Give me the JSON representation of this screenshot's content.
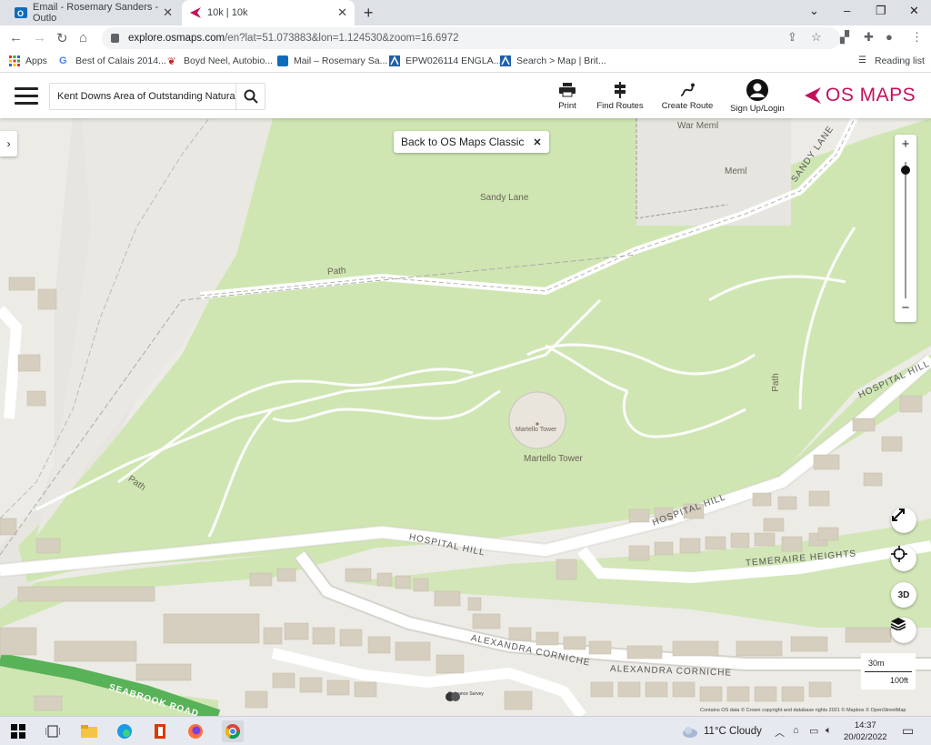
{
  "browser": {
    "tabs": [
      {
        "title": "Email - Rosemary Sanders - Outlo",
        "active": false
      },
      {
        "title": "10k | 10k",
        "active": true
      }
    ],
    "new_tab": "+",
    "window_controls": {
      "minimize": "⌄",
      "restore": "–",
      "maximize": "❐",
      "close": "✕"
    },
    "url_host": "explore.osmaps.com",
    "url_path": "/en?lat=51.073883&lon=1.124530&zoom=16.6972",
    "bookmarks": [
      {
        "label": "Apps",
        "icon": "apps-icon"
      },
      {
        "label": "Best of Calais 2014...",
        "icon": "google-icon"
      },
      {
        "label": "Boyd Neel, Autobio...",
        "icon": "bird-icon"
      },
      {
        "label": "Mail – Rosemary Sa...",
        "icon": "outlook-icon"
      },
      {
        "label": "EPW026114 ENGLA...",
        "icon": "historic-england-icon"
      },
      {
        "label": "Search > Map | Brit...",
        "icon": "historic-england-icon"
      }
    ],
    "reading_list": "Reading list"
  },
  "app": {
    "search_value": "Kent Downs Area of Outstanding Natural",
    "actions": [
      {
        "label": "Print",
        "icon": "printer-icon"
      },
      {
        "label": "Find Routes",
        "icon": "route-sign-icon"
      },
      {
        "label": "Create Route",
        "icon": "create-route-icon"
      },
      {
        "label": "Sign Up/Login",
        "icon": "user-icon"
      }
    ],
    "brand": "OS MAPS",
    "brand_color": "#c3105d"
  },
  "map": {
    "banner": "Back to OS Maps Classic",
    "banner_close": "✕",
    "side_toggle": "›",
    "zoom_in": "+",
    "zoom_out": "−",
    "zoom_level": 16.6972,
    "controls": [
      {
        "name": "fullscreen",
        "label": "",
        "icon": "expand-icon"
      },
      {
        "name": "locate",
        "label": "",
        "icon": "crosshair-icon"
      },
      {
        "name": "3d",
        "label": "3D",
        "icon": "3d-rotate-icon"
      },
      {
        "name": "layers",
        "label": "",
        "icon": "layers-icon"
      }
    ],
    "labels": {
      "war_meml": "War Meml",
      "meml": "Meml",
      "sandy_lane_area": "Sandy Lane",
      "sandy_lane_road": "SANDY LANE",
      "path_north": "Path",
      "path_west": "Path",
      "path_east": "Path",
      "martello_small": "Martello Tower",
      "martello": "Martello Tower",
      "hospital_hill_1": "HOSPITAL HILL",
      "hospital_hill_2": "HOSPITAL HILL",
      "hospital_hill_3": "HOSPITAL HILL",
      "temeraire": "TEMERAIRE HEIGHTS",
      "alexandra_1": "ALEXANDRA CORNICHE",
      "alexandra_2": "ALEXANDRA CORNICHE",
      "seabrook": "SEABROOK ROAD"
    },
    "scale_metric": "30m",
    "scale_imperial": "100ft",
    "attribution": "Contains OS data © Crown copyright and database rights 2021 © Mapbox © OpenStreetMap",
    "os_logo_text": "Ordnance Survey"
  },
  "taskbar": {
    "weather": "11°C  Cloudy",
    "time": "14:37",
    "date": "20/02/2022"
  }
}
